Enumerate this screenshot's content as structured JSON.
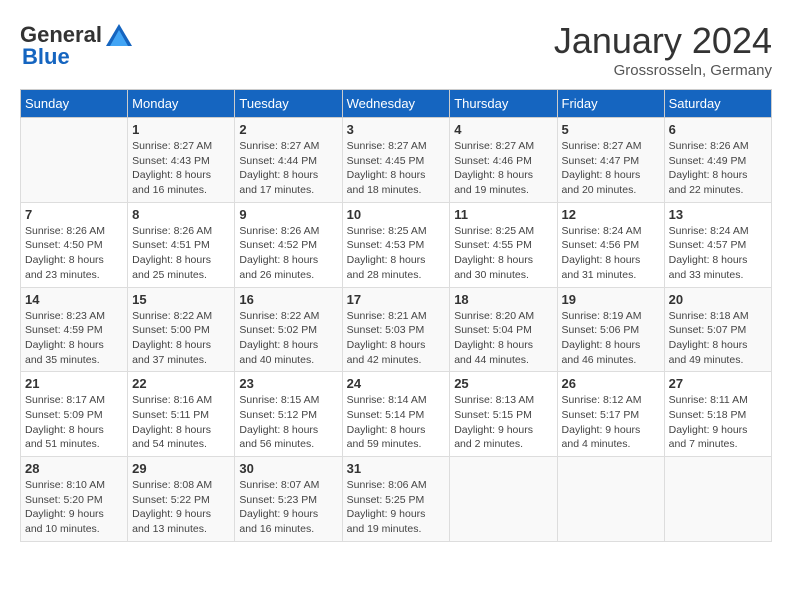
{
  "logo": {
    "general": "General",
    "blue": "Blue"
  },
  "title": "January 2024",
  "location": "Grossrosseln, Germany",
  "days_of_week": [
    "Sunday",
    "Monday",
    "Tuesday",
    "Wednesday",
    "Thursday",
    "Friday",
    "Saturday"
  ],
  "weeks": [
    [
      {
        "day": "",
        "info": ""
      },
      {
        "day": "1",
        "info": "Sunrise: 8:27 AM\nSunset: 4:43 PM\nDaylight: 8 hours\nand 16 minutes."
      },
      {
        "day": "2",
        "info": "Sunrise: 8:27 AM\nSunset: 4:44 PM\nDaylight: 8 hours\nand 17 minutes."
      },
      {
        "day": "3",
        "info": "Sunrise: 8:27 AM\nSunset: 4:45 PM\nDaylight: 8 hours\nand 18 minutes."
      },
      {
        "day": "4",
        "info": "Sunrise: 8:27 AM\nSunset: 4:46 PM\nDaylight: 8 hours\nand 19 minutes."
      },
      {
        "day": "5",
        "info": "Sunrise: 8:27 AM\nSunset: 4:47 PM\nDaylight: 8 hours\nand 20 minutes."
      },
      {
        "day": "6",
        "info": "Sunrise: 8:26 AM\nSunset: 4:49 PM\nDaylight: 8 hours\nand 22 minutes."
      }
    ],
    [
      {
        "day": "7",
        "info": "Sunrise: 8:26 AM\nSunset: 4:50 PM\nDaylight: 8 hours\nand 23 minutes."
      },
      {
        "day": "8",
        "info": "Sunrise: 8:26 AM\nSunset: 4:51 PM\nDaylight: 8 hours\nand 25 minutes."
      },
      {
        "day": "9",
        "info": "Sunrise: 8:26 AM\nSunset: 4:52 PM\nDaylight: 8 hours\nand 26 minutes."
      },
      {
        "day": "10",
        "info": "Sunrise: 8:25 AM\nSunset: 4:53 PM\nDaylight: 8 hours\nand 28 minutes."
      },
      {
        "day": "11",
        "info": "Sunrise: 8:25 AM\nSunset: 4:55 PM\nDaylight: 8 hours\nand 30 minutes."
      },
      {
        "day": "12",
        "info": "Sunrise: 8:24 AM\nSunset: 4:56 PM\nDaylight: 8 hours\nand 31 minutes."
      },
      {
        "day": "13",
        "info": "Sunrise: 8:24 AM\nSunset: 4:57 PM\nDaylight: 8 hours\nand 33 minutes."
      }
    ],
    [
      {
        "day": "14",
        "info": "Sunrise: 8:23 AM\nSunset: 4:59 PM\nDaylight: 8 hours\nand 35 minutes."
      },
      {
        "day": "15",
        "info": "Sunrise: 8:22 AM\nSunset: 5:00 PM\nDaylight: 8 hours\nand 37 minutes."
      },
      {
        "day": "16",
        "info": "Sunrise: 8:22 AM\nSunset: 5:02 PM\nDaylight: 8 hours\nand 40 minutes."
      },
      {
        "day": "17",
        "info": "Sunrise: 8:21 AM\nSunset: 5:03 PM\nDaylight: 8 hours\nand 42 minutes."
      },
      {
        "day": "18",
        "info": "Sunrise: 8:20 AM\nSunset: 5:04 PM\nDaylight: 8 hours\nand 44 minutes."
      },
      {
        "day": "19",
        "info": "Sunrise: 8:19 AM\nSunset: 5:06 PM\nDaylight: 8 hours\nand 46 minutes."
      },
      {
        "day": "20",
        "info": "Sunrise: 8:18 AM\nSunset: 5:07 PM\nDaylight: 8 hours\nand 49 minutes."
      }
    ],
    [
      {
        "day": "21",
        "info": "Sunrise: 8:17 AM\nSunset: 5:09 PM\nDaylight: 8 hours\nand 51 minutes."
      },
      {
        "day": "22",
        "info": "Sunrise: 8:16 AM\nSunset: 5:11 PM\nDaylight: 8 hours\nand 54 minutes."
      },
      {
        "day": "23",
        "info": "Sunrise: 8:15 AM\nSunset: 5:12 PM\nDaylight: 8 hours\nand 56 minutes."
      },
      {
        "day": "24",
        "info": "Sunrise: 8:14 AM\nSunset: 5:14 PM\nDaylight: 8 hours\nand 59 minutes."
      },
      {
        "day": "25",
        "info": "Sunrise: 8:13 AM\nSunset: 5:15 PM\nDaylight: 9 hours\nand 2 minutes."
      },
      {
        "day": "26",
        "info": "Sunrise: 8:12 AM\nSunset: 5:17 PM\nDaylight: 9 hours\nand 4 minutes."
      },
      {
        "day": "27",
        "info": "Sunrise: 8:11 AM\nSunset: 5:18 PM\nDaylight: 9 hours\nand 7 minutes."
      }
    ],
    [
      {
        "day": "28",
        "info": "Sunrise: 8:10 AM\nSunset: 5:20 PM\nDaylight: 9 hours\nand 10 minutes."
      },
      {
        "day": "29",
        "info": "Sunrise: 8:08 AM\nSunset: 5:22 PM\nDaylight: 9 hours\nand 13 minutes."
      },
      {
        "day": "30",
        "info": "Sunrise: 8:07 AM\nSunset: 5:23 PM\nDaylight: 9 hours\nand 16 minutes."
      },
      {
        "day": "31",
        "info": "Sunrise: 8:06 AM\nSunset: 5:25 PM\nDaylight: 9 hours\nand 19 minutes."
      },
      {
        "day": "",
        "info": ""
      },
      {
        "day": "",
        "info": ""
      },
      {
        "day": "",
        "info": ""
      }
    ]
  ]
}
